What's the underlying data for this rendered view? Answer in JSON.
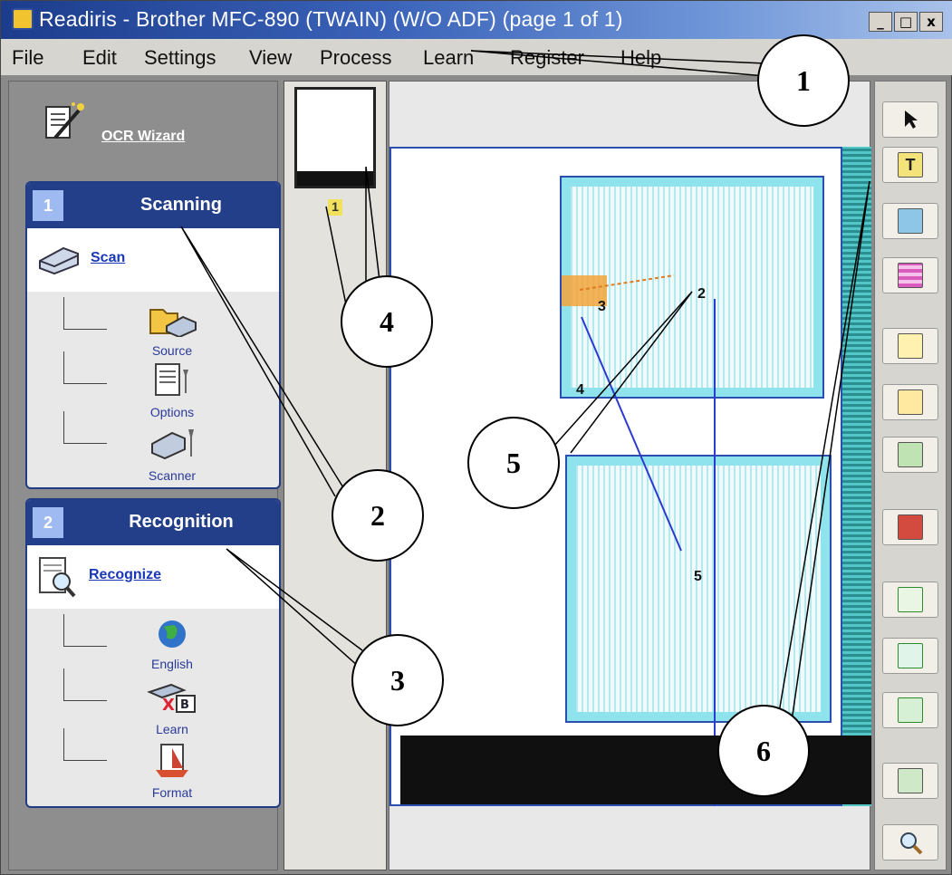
{
  "window": {
    "title": "Readiris - Brother MFC-890 (TWAIN) (W/O ADF) (page 1 of 1)",
    "controls": [
      "_",
      "□",
      "x"
    ]
  },
  "menu": [
    "File",
    "Edit",
    "Settings",
    "View",
    "Process",
    "Learn",
    "Register",
    "Help"
  ],
  "wizard": {
    "label": "OCR Wizard",
    "icon": "wizard-icon"
  },
  "sections": [
    {
      "number": "1",
      "title": "Scanning",
      "main_link": "Scan",
      "items": [
        {
          "label": "Source",
          "icon": "folder-scanner-icon"
        },
        {
          "label": "Options",
          "icon": "options-icon"
        },
        {
          "label": "Scanner",
          "icon": "scanner-wrench-icon"
        }
      ]
    },
    {
      "number": "2",
      "title": "Recognition",
      "main_link": "Recognize",
      "items": [
        {
          "label": "English",
          "icon": "globe-icon"
        },
        {
          "label": "Learn",
          "icon": "learn-icon"
        },
        {
          "label": "Format",
          "icon": "format-icon"
        }
      ]
    }
  ],
  "thumbnail": {
    "page_number": "1"
  },
  "document": {
    "zone_labels": [
      "2",
      "3",
      "4",
      "5"
    ]
  },
  "toolbar": {
    "tools": [
      "pointer-icon",
      "text-zone-icon",
      "graphic-zone-icon",
      "table-zone-icon",
      "add-zone-icon",
      "insert-page-icon",
      "replace-page-icon",
      "book-icon",
      "zoom-fit-icon",
      "fit-width-icon",
      "actual-size-icon",
      "rotate-icon",
      "magnifier-icon"
    ]
  },
  "callouts": [
    "1",
    "2",
    "3",
    "4",
    "5",
    "6"
  ]
}
